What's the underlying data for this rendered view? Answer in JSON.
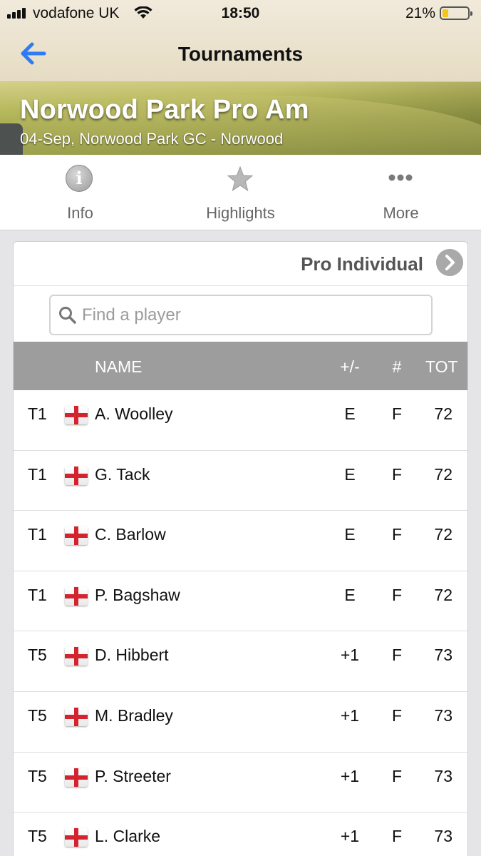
{
  "status_bar": {
    "carrier": "vodafone UK",
    "time": "18:50",
    "battery_percent": "21%",
    "battery_level": 0.21,
    "battery_color": "#f6c51a"
  },
  "nav": {
    "back_icon": "back-arrow-icon",
    "title": "Tournaments",
    "accent": "#2f7bf5"
  },
  "event": {
    "title": "Norwood Park Pro Am",
    "subtitle": "04-Sep, Norwood Park GC - Norwood"
  },
  "tabs": [
    {
      "label": "Info",
      "icon": "info-icon"
    },
    {
      "label": "Highlights",
      "icon": "star-icon"
    },
    {
      "label": "More",
      "icon": "more-dots-icon"
    }
  ],
  "division": {
    "label": "Pro Individual",
    "icon": "chevron-right-icon"
  },
  "search": {
    "placeholder": "Find a player",
    "value": ""
  },
  "table": {
    "columns": {
      "pos": "",
      "name": "NAME",
      "par": "+/-",
      "thru": "#",
      "tot": "TOT"
    },
    "rows": [
      {
        "pos": "T1",
        "flag": "england-flag-icon",
        "name": "A. Woolley",
        "par": "E",
        "thru": "F",
        "tot": "72"
      },
      {
        "pos": "T1",
        "flag": "england-flag-icon",
        "name": "G. Tack",
        "par": "E",
        "thru": "F",
        "tot": "72"
      },
      {
        "pos": "T1",
        "flag": "england-flag-icon",
        "name": "C. Barlow",
        "par": "E",
        "thru": "F",
        "tot": "72"
      },
      {
        "pos": "T1",
        "flag": "england-flag-icon",
        "name": "P. Bagshaw",
        "par": "E",
        "thru": "F",
        "tot": "72"
      },
      {
        "pos": "T5",
        "flag": "england-flag-icon",
        "name": "D. Hibbert",
        "par": "+1",
        "thru": "F",
        "tot": "73"
      },
      {
        "pos": "T5",
        "flag": "england-flag-icon",
        "name": "M. Bradley",
        "par": "+1",
        "thru": "F",
        "tot": "73"
      },
      {
        "pos": "T5",
        "flag": "england-flag-icon",
        "name": "P. Streeter",
        "par": "+1",
        "thru": "F",
        "tot": "73"
      },
      {
        "pos": "T5",
        "flag": "england-flag-icon",
        "name": "L. Clarke",
        "par": "+1",
        "thru": "F",
        "tot": "73"
      }
    ]
  }
}
